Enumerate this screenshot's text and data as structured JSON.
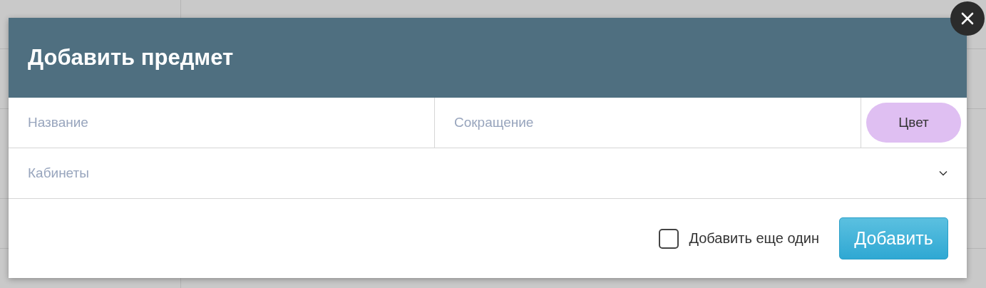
{
  "dialog": {
    "title": "Добавить предмет",
    "fields": [
      {
        "placeholder": "Название"
      },
      {
        "placeholder": "Сокращение"
      }
    ],
    "color_button": "Цвет",
    "select": {
      "placeholder": "Кабинеты"
    },
    "add_another": {
      "label": "Добавить еще один",
      "checked": false
    },
    "submit_button": "Добавить"
  }
}
